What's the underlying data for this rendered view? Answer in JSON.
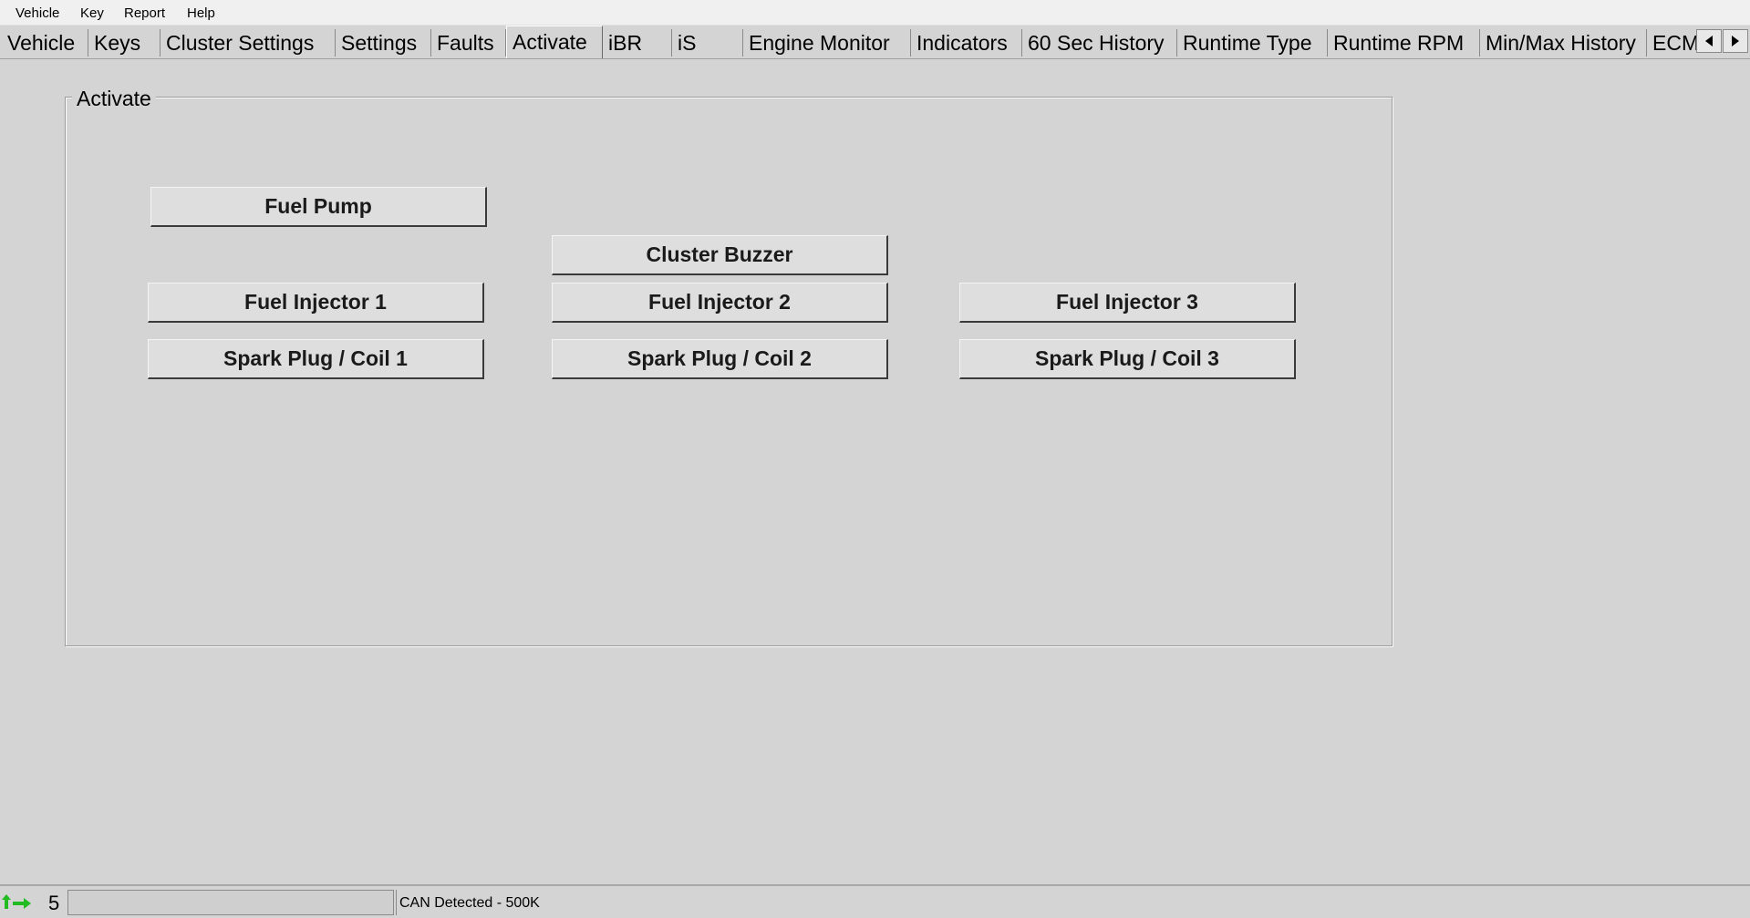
{
  "menu": {
    "items": [
      "Vehicle",
      "Key",
      "Report",
      "Help"
    ]
  },
  "tabs": [
    {
      "label": "Vehicle"
    },
    {
      "label": "Keys"
    },
    {
      "label": "Cluster Settings"
    },
    {
      "label": "Settings"
    },
    {
      "label": "Faults"
    },
    {
      "label": "Activate",
      "active": true
    },
    {
      "label": "iBR"
    },
    {
      "label": "iS"
    },
    {
      "label": "Engine Monitor"
    },
    {
      "label": "Indicators"
    },
    {
      "label": "60 Sec History"
    },
    {
      "label": "Runtime Type"
    },
    {
      "label": "Runtime RPM"
    },
    {
      "label": "Min/Max History"
    },
    {
      "label": "ECM"
    }
  ],
  "tab_scroll": {
    "left_icon": "triangle-left",
    "right_icon": "triangle-right"
  },
  "group": {
    "title": "Activate",
    "buttons": {
      "fuel_pump": "Fuel Pump",
      "cluster_buzzer": "Cluster Buzzer",
      "fuel_injector_1": "Fuel Injector 1",
      "fuel_injector_2": "Fuel Injector 2",
      "fuel_injector_3": "Fuel Injector 3",
      "spark_plug_coil_1": "Spark Plug / Coil 1",
      "spark_plug_coil_2": "Spark Plug / Coil 2",
      "spark_plug_coil_3": "Spark Plug / Coil 3"
    }
  },
  "status": {
    "icon": "green-arrows-icon",
    "icon_color": "#22bb22",
    "count": "5",
    "message": "CAN Detected - 500K"
  }
}
